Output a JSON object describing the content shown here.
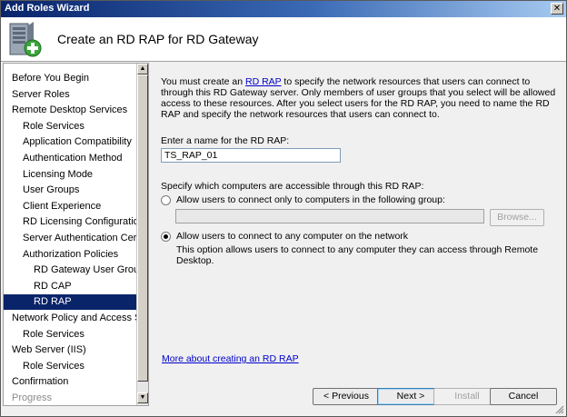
{
  "window": {
    "title": "Add Roles Wizard",
    "close_glyph": "✕"
  },
  "header": {
    "title": "Create an RD RAP for RD Gateway",
    "icon": "server-add-icon"
  },
  "nav": {
    "items": [
      {
        "label": "Before You Begin",
        "level": 0
      },
      {
        "label": "Server Roles",
        "level": 0
      },
      {
        "label": "Remote Desktop Services",
        "level": 0
      },
      {
        "label": "Role Services",
        "level": 1
      },
      {
        "label": "Application Compatibility",
        "level": 1
      },
      {
        "label": "Authentication Method",
        "level": 1
      },
      {
        "label": "Licensing Mode",
        "level": 1
      },
      {
        "label": "User Groups",
        "level": 1
      },
      {
        "label": "Client Experience",
        "level": 1
      },
      {
        "label": "RD Licensing Configuration",
        "level": 1
      },
      {
        "label": "Server Authentication Certificate",
        "level": 1
      },
      {
        "label": "Authorization Policies",
        "level": 1
      },
      {
        "label": "RD Gateway User Groups",
        "level": 2
      },
      {
        "label": "RD CAP",
        "level": 2
      },
      {
        "label": "RD RAP",
        "level": 2,
        "selected": true
      },
      {
        "label": "Network Policy and Access Services",
        "level": 0
      },
      {
        "label": "Role Services",
        "level": 1
      },
      {
        "label": "Web Server (IIS)",
        "level": 0
      },
      {
        "label": "Role Services",
        "level": 1
      },
      {
        "label": "Confirmation",
        "level": 0
      },
      {
        "label": "Progress",
        "level": 0,
        "disabled": true
      }
    ],
    "scroll_up": "▲",
    "scroll_down": "▼"
  },
  "content": {
    "intro_before_link": "You must create an ",
    "intro_link": "RD RAP",
    "intro_after_link": " to specify the network resources that users can connect to through this RD Gateway server. Only members of user groups that you select will be allowed access to these resources. After you select users for the RD RAP, you need to name the RD RAP and specify the network resources that users can connect to.",
    "name_label": "Enter a name for the RD RAP:",
    "name_value": "TS_RAP_01",
    "computers_label": "Specify which computers are accessible through this RD RAP:",
    "option_group_label": "Allow users to connect only to computers in the following group:",
    "group_value": "",
    "browse_label": "Browse...",
    "option_any_label": "Allow users to connect to any computer on the network",
    "option_any_desc": "This option allows users to connect to any computer they can access through Remote Desktop.",
    "selected_option": "any",
    "more_link": "More about creating an RD RAP"
  },
  "footer": {
    "previous": "< Previous",
    "next": "Next >",
    "install": "Install",
    "cancel": "Cancel"
  }
}
